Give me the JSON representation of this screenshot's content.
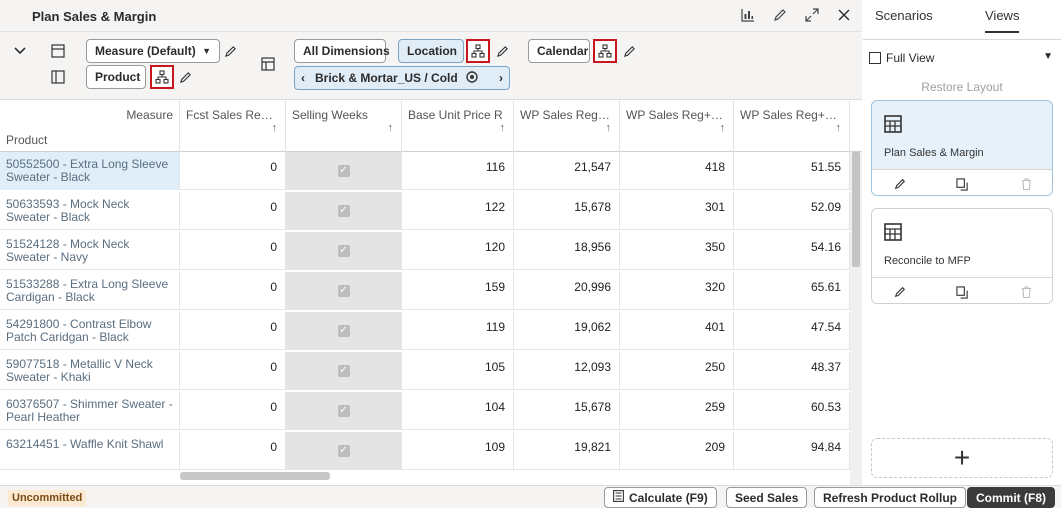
{
  "window": {
    "title": "Plan Sales & Margin"
  },
  "toolbar": {
    "measure_label": "Measure (Default)",
    "product_label": "Product",
    "all_dimensions_label": "All Dimensions",
    "location_label": "Location",
    "calendar_label": "Calendar",
    "location_value": "Brick & Mortar_US / Cold"
  },
  "grid": {
    "corner_measure": "Measure",
    "corner_product": "Product",
    "columns": [
      "Fcst Sales Reg+P...",
      "Selling Weeks",
      "Base Unit Price R",
      "WP Sales Reg+Pr...",
      "WP Sales Reg+Pr...",
      "WP Sales Reg+Pr..."
    ],
    "rows": [
      {
        "product": "50552500 - Extra Long Sleeve Sweater - Black",
        "fcst": "0",
        "base": "116",
        "wp1": "21,547",
        "wp2": "418",
        "wp3": "51.55"
      },
      {
        "product": "50633593 - Mock Neck Sweater - Black",
        "fcst": "0",
        "base": "122",
        "wp1": "15,678",
        "wp2": "301",
        "wp3": "52.09"
      },
      {
        "product": "51524128 - Mock Neck Sweater - Navy",
        "fcst": "0",
        "base": "120",
        "wp1": "18,956",
        "wp2": "350",
        "wp3": "54.16"
      },
      {
        "product": "51533288 - Extra Long Sleeve Cardigan - Black",
        "fcst": "0",
        "base": "159",
        "wp1": "20,996",
        "wp2": "320",
        "wp3": "65.61"
      },
      {
        "product": "54291800 - Contrast Elbow Patch Caridgan - Black",
        "fcst": "0",
        "base": "119",
        "wp1": "19,062",
        "wp2": "401",
        "wp3": "47.54"
      },
      {
        "product": "59077518 - Metallic V Neck Sweater - Khaki",
        "fcst": "0",
        "base": "105",
        "wp1": "12,093",
        "wp2": "250",
        "wp3": "48.37"
      },
      {
        "product": "60376507 - Shimmer Sweater - Pearl Heather",
        "fcst": "0",
        "base": "104",
        "wp1": "15,678",
        "wp2": "259",
        "wp3": "60.53"
      },
      {
        "product": "63214451 - Waffle Knit Shawl",
        "fcst": "0",
        "base": "109",
        "wp1": "19,821",
        "wp2": "209",
        "wp3": "94.84"
      }
    ]
  },
  "status": {
    "badge": "Uncommitted",
    "calculate_label": "Calculate (F9)",
    "seed_label": "Seed Sales",
    "refresh_label": "Refresh Product Rollup",
    "commit_label": "Commit (F8)"
  },
  "side": {
    "tab_scenarios": "Scenarios",
    "tab_views": "Views",
    "full_view_label": "Full View",
    "restore_label": "Restore Layout",
    "views": [
      {
        "title": "Plan Sales & Margin"
      },
      {
        "title": "Reconcile to MFP"
      }
    ]
  },
  "colors": {
    "accent_red": "#c9151e",
    "selection_blue": "#dfeef8",
    "primary_button": "#3b3b3b"
  }
}
